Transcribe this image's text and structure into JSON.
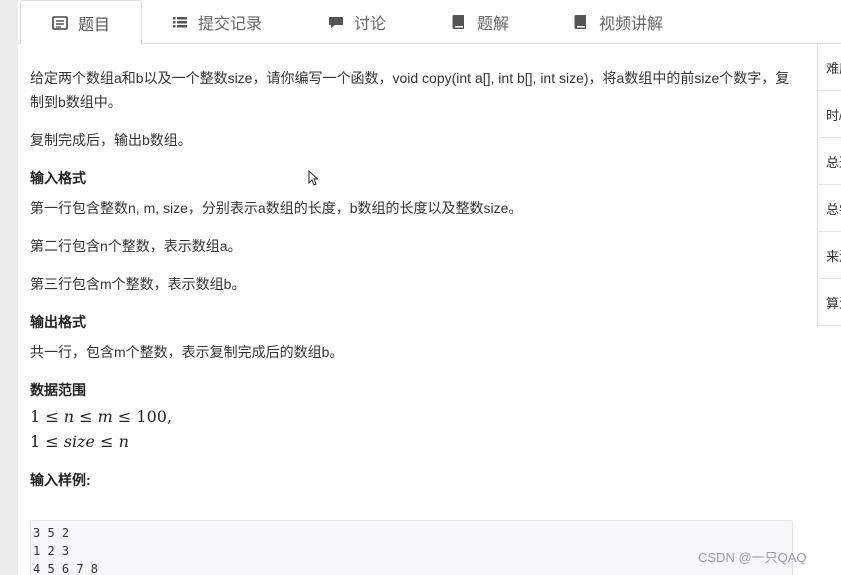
{
  "tabs": [
    {
      "label": "题目",
      "icon": "list-icon",
      "active": true
    },
    {
      "label": "提交记录",
      "icon": "list-icon",
      "active": false
    },
    {
      "label": "讨论",
      "icon": "comment-icon",
      "active": false
    },
    {
      "label": "题解",
      "icon": "book-icon",
      "active": false
    },
    {
      "label": "视频讲解",
      "icon": "book-icon",
      "active": false
    }
  ],
  "problem": {
    "desc1": "给定两个数组a和b以及一个整数size，请你编写一个函数，void copy(int a[], int b[], int size)，将a数组中的前size个数字，复制到b数组中。",
    "desc2": "复制完成后，输出b数组。",
    "input_title": "输入格式",
    "input_line1": "第一行包含整数n, m, size，分别表示a数组的长度，b数组的长度以及整数size。",
    "input_line2": "第二行包含n个整数，表示数组a。",
    "input_line3": "第三行包含m个整数，表示数组b。",
    "output_title": "输出格式",
    "output_line": "共一行，包含m个整数，表示复制完成后的数组b。",
    "range_title": "数据范围",
    "sample_title": "输入样例:",
    "sample_lines": [
      "3 5 2",
      "1 2 3",
      "4 5 6 7 8"
    ]
  },
  "sidebar": {
    "items": [
      "难度",
      "时/",
      "总通",
      "总尝",
      "来源",
      "算法"
    ]
  },
  "watermark": "CSDN @一只QAQ",
  "colors": {
    "border": "#dcdcdc",
    "sample_bg": "#f7f7f9"
  }
}
